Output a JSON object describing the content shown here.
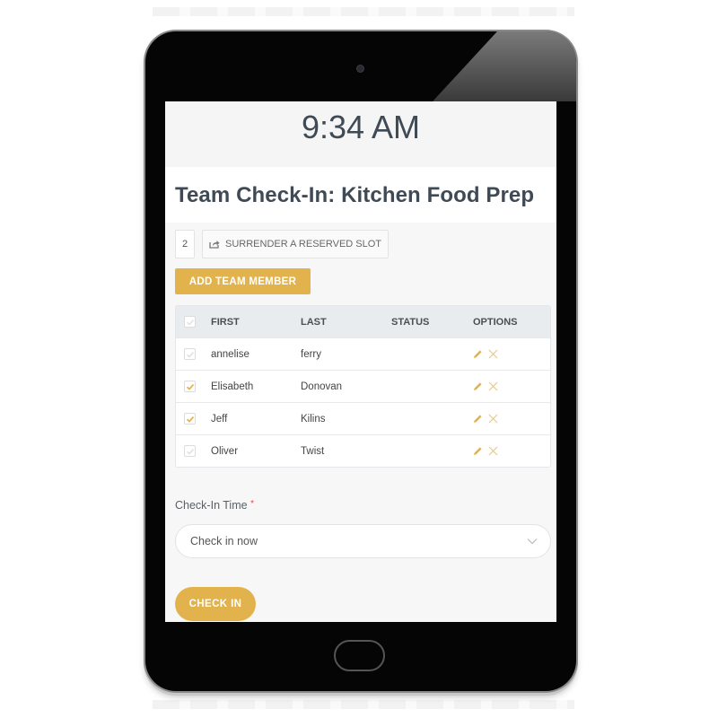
{
  "clock": {
    "time": "9:34 AM"
  },
  "page": {
    "title": "Team Check-In: Kitchen Food Prep"
  },
  "slots": {
    "count": "2",
    "surrender_label": "SURRENDER A RESERVED SLOT",
    "surrender_icon": "share-icon"
  },
  "actions": {
    "add_member_label": "ADD TEAM MEMBER",
    "check_in_label": "CHECK IN"
  },
  "table": {
    "headers": {
      "first": "FIRST",
      "last": "LAST",
      "status": "STATUS",
      "options": "OPTIONS"
    },
    "rows": [
      {
        "first": "annelise",
        "last": "ferry",
        "status": "",
        "checked": false
      },
      {
        "first": "Elisabeth",
        "last": "Donovan",
        "status": "",
        "checked": true
      },
      {
        "first": "Jeff",
        "last": "Kilins",
        "status": "",
        "checked": true
      },
      {
        "first": "Oliver",
        "last": "Twist",
        "status": "",
        "checked": false
      }
    ],
    "option_icons": [
      "pencil-icon",
      "close-icon"
    ]
  },
  "check_in_time": {
    "label": "Check-In Time",
    "required_mark": "*",
    "selected": "Check in now"
  },
  "colors": {
    "accent": "#e2b34d",
    "text": "#3f4a55",
    "required": "#e04a4a",
    "header_bg": "#e9ecef"
  }
}
